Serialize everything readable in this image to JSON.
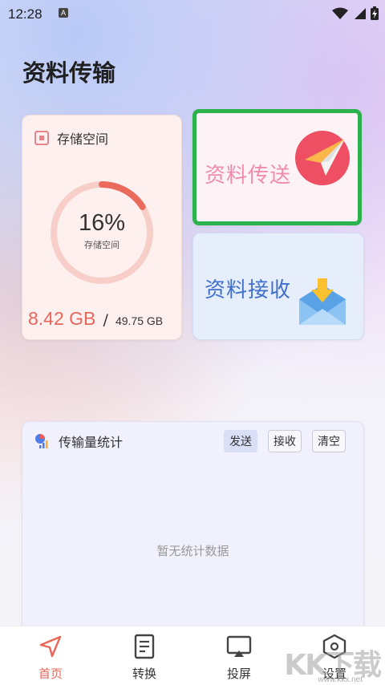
{
  "status_bar": {
    "time": "12:28",
    "notification_badge": "A"
  },
  "page": {
    "title": "资料传输"
  },
  "storage": {
    "label": "存储空间",
    "percent_text": "16%",
    "percent_value": 0.16,
    "percent_caption": "存储空间",
    "used": "8.42 GB",
    "separator": "/",
    "total": "49.75 GB"
  },
  "send_card": {
    "label": "资料传送"
  },
  "receive_card": {
    "label": "资料接收"
  },
  "stats": {
    "title": "传输量统计",
    "buttons": {
      "send": "发送",
      "receive": "接收",
      "clear": "清空"
    },
    "empty_text": "暂无统计数据"
  },
  "tabs": [
    {
      "label": "首页",
      "icon": "navigation-arrow-icon",
      "active": true
    },
    {
      "label": "转换",
      "icon": "document-icon",
      "active": false
    },
    {
      "label": "投屏",
      "icon": "screen-cast-icon",
      "active": false
    },
    {
      "label": "设置",
      "icon": "settings-box-icon",
      "active": false
    }
  ],
  "watermark": {
    "logo_text": "KK下载",
    "site": "www.kkx.net"
  },
  "colors": {
    "accent": "#e8665a",
    "send_text": "#f08bab",
    "receive_text": "#3f6fcb",
    "selection_border": "#2bb24c"
  }
}
